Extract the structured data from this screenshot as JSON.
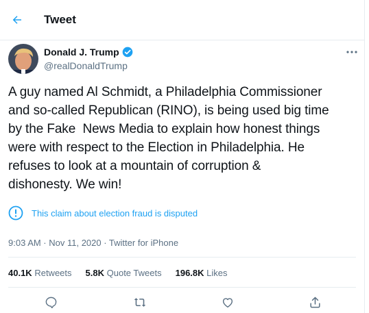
{
  "header": {
    "title": "Tweet"
  },
  "author": {
    "name": "Donald J. Trump",
    "handle": "@realDonaldTrump",
    "verified": true
  },
  "tweet": {
    "text": "A guy named Al Schmidt, a Philadelphia Commissioner\nand so-called Republican (RINO), is being used big time\nby the Fake  News Media to explain how honest things\nwere with respect to the Election in Philadelphia. He\nrefuses to look at a mountain of corruption &\ndishonesty. We win!"
  },
  "notice": {
    "text": "This claim about election fraud is disputed"
  },
  "meta": {
    "timestamp": "9:03 AM · Nov 11, 2020 · Twitter for iPhone"
  },
  "stats": {
    "retweets_count": "40.1K",
    "retweets_label": "Retweets",
    "quotes_count": "5.8K",
    "quotes_label": "Quote Tweets",
    "likes_count": "196.8K",
    "likes_label": "Likes"
  },
  "icons": {
    "back": "arrow-left-icon",
    "verified": "verified-badge-icon",
    "more": "more-dots-icon",
    "notice": "info-circle-icon",
    "reply": "reply-icon",
    "retweet": "retweet-icon",
    "like": "heart-icon",
    "share": "share-icon"
  },
  "colors": {
    "accent": "#1da1f2",
    "muted": "#5b7083",
    "text": "#0f1419",
    "border": "#e6ecf0"
  }
}
